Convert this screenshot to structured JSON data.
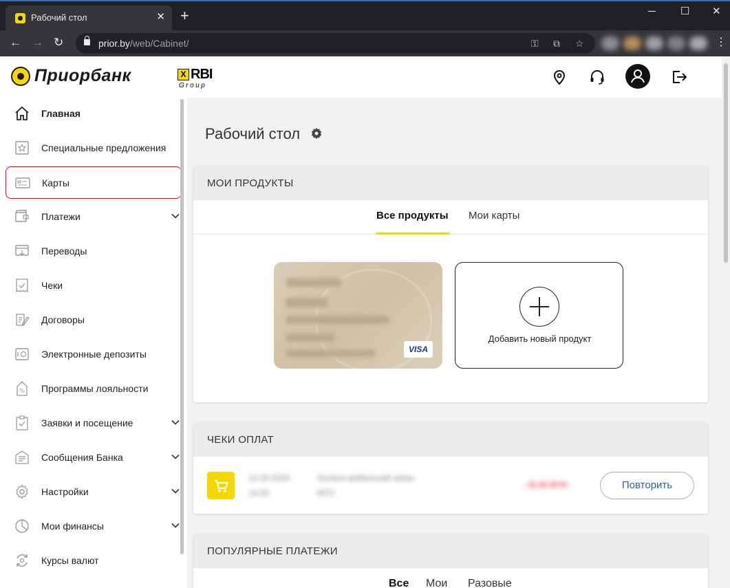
{
  "browser": {
    "tab_title": "Рабочий стол",
    "tab_close": "✕",
    "new_tab": "+",
    "win_min": "─",
    "win_max": "☐",
    "win_close": "✕",
    "back": "←",
    "forward": "→",
    "reload": "↻",
    "url_host": "prior.by",
    "url_path": "/web/Cabinet/",
    "key_icon": "⚿",
    "translate_icon": "⧉",
    "star_icon": "☆",
    "menu_icon": "⋮"
  },
  "brand": {
    "name": "Приорбанк",
    "rbi_mark": "X",
    "rbi": "RBI",
    "rbi_group": "Group",
    "accent": "#f5d800"
  },
  "sidebar": {
    "items": [
      {
        "label": "Главная",
        "icon": "home-icon"
      },
      {
        "label": "Специальные предложения",
        "icon": "star-icon"
      },
      {
        "label": "Карты",
        "icon": "card-icon"
      },
      {
        "label": "Платежи",
        "icon": "wallet-icon"
      },
      {
        "label": "Переводы",
        "icon": "transfer-icon"
      },
      {
        "label": "Чеки",
        "icon": "receipt-icon"
      },
      {
        "label": "Договоры",
        "icon": "contract-icon"
      },
      {
        "label": "Электронные депозиты",
        "icon": "deposit-icon"
      },
      {
        "label": "Программы лояльности",
        "icon": "loyalty-icon"
      },
      {
        "label": "Заявки и посещение",
        "icon": "clipboard-icon"
      },
      {
        "label": "Сообщения Банка",
        "icon": "message-icon"
      },
      {
        "label": "Настройки",
        "icon": "gear-icon"
      },
      {
        "label": "Мои финансы",
        "icon": "pie-chart-icon"
      },
      {
        "label": "Курсы валют",
        "icon": "exchange-icon"
      }
    ]
  },
  "main": {
    "title": "Рабочий стол",
    "products": {
      "heading": "МОИ ПРОДУКТЫ",
      "tab_all": "Все продукты",
      "tab_cards": "Мои карты",
      "card_brand": "VISA",
      "card_holder": "IVAN PETROV",
      "card_number": "4916 •••• •••• 2381",
      "card_expiry": "09/27",
      "card_balance": "1 254,30 BYN",
      "add_label": "Добавить новый продукт"
    },
    "receipts": {
      "heading": "ЧЕКИ ОПЛАТ",
      "date": "12.03.2024",
      "time": "14:32",
      "description": "Оплата мобильной связи",
      "description_2": "МТС",
      "amount": "- 15,00 BYN",
      "repeat_button": "Повторить"
    },
    "popular": {
      "heading": "ПОПУЛЯРНЫЕ ПЛАТЕЖИ",
      "tab_all": "Все",
      "tab_mine": "Мои",
      "tab_once": "Разовые"
    }
  }
}
